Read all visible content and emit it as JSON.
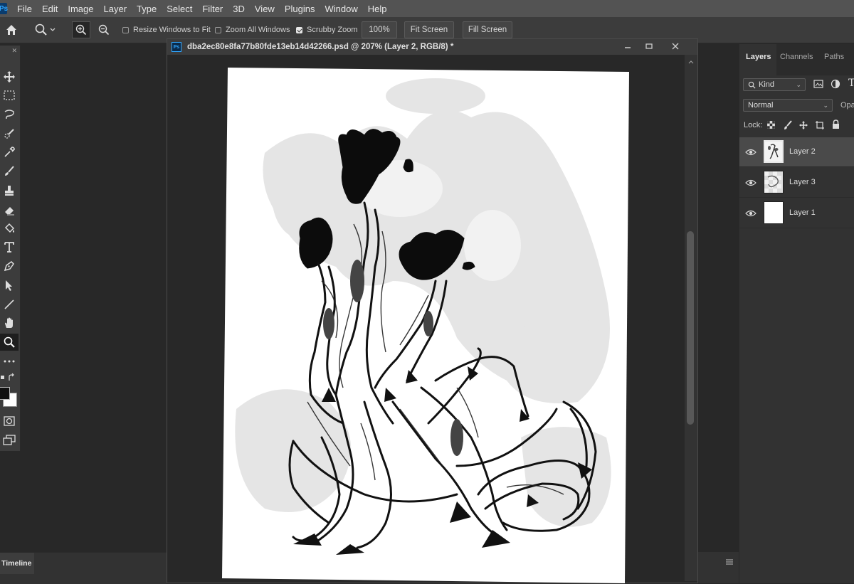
{
  "menu": {
    "logo": "Ps",
    "items": [
      "File",
      "Edit",
      "Image",
      "Layer",
      "Type",
      "Select",
      "Filter",
      "3D",
      "View",
      "Plugins",
      "Window",
      "Help"
    ]
  },
  "options": {
    "resize_windows": "Resize Windows to Fit",
    "zoom_all": "Zoom All Windows",
    "scrubby_zoom": "Scrubby Zoom",
    "zoom_value": "100%",
    "fit_screen": "Fit Screen",
    "fill_screen": "Fill Screen"
  },
  "document": {
    "title": "dba2ec80e8fa77b80fde13eb14d42266.psd @ 207% (Layer 2, RGB/8) *",
    "icon": "Ps"
  },
  "panel": {
    "tabs": [
      "Layers",
      "Channels",
      "Paths"
    ],
    "kind_filter": "Kind",
    "blend_mode": "Normal",
    "opacity_label": "Opa",
    "lock_label": "Lock:",
    "layers": [
      {
        "name": "Layer 2",
        "selected": true
      },
      {
        "name": "Layer 3",
        "selected": false
      },
      {
        "name": "Layer 1",
        "selected": false
      }
    ]
  },
  "timeline": {
    "label": "Timeline"
  },
  "colors": {
    "ui_dark": "#282828",
    "panel": "#323232",
    "accent": "#31a8ff"
  }
}
